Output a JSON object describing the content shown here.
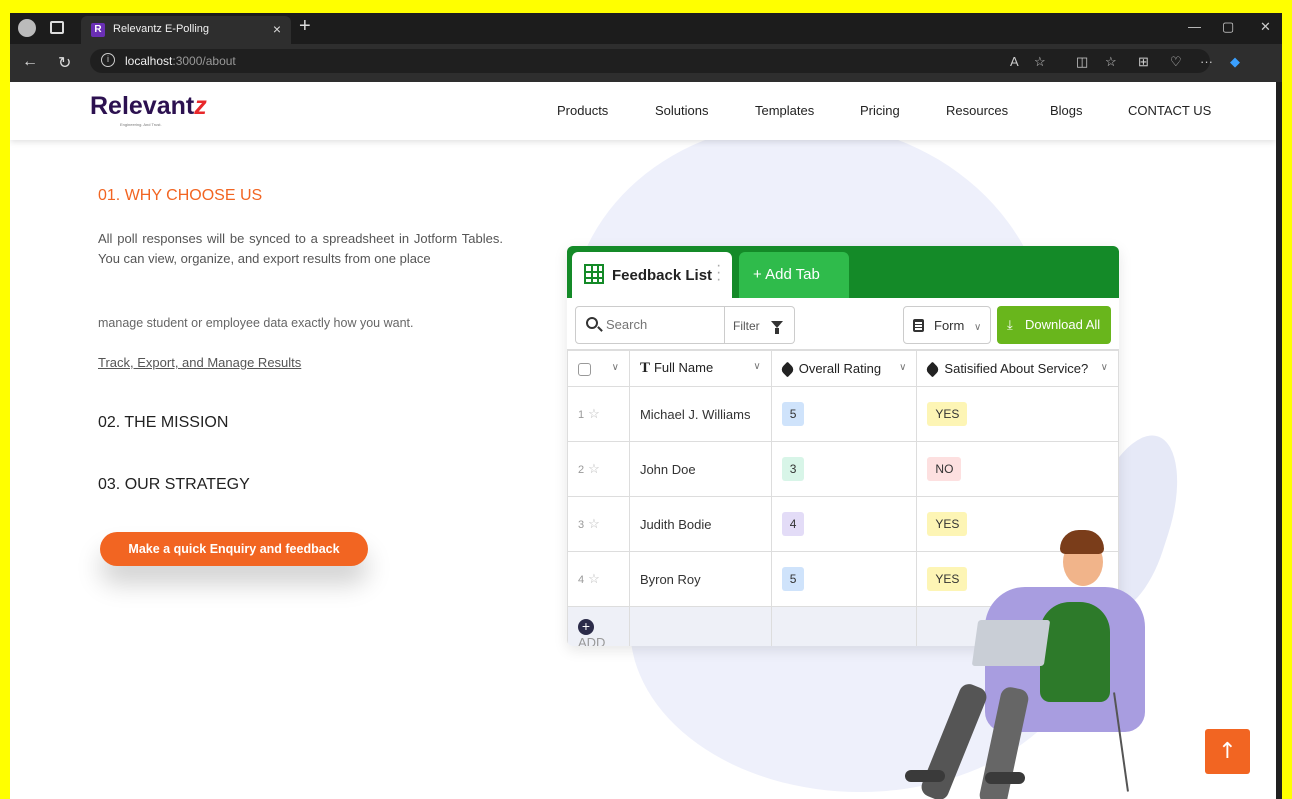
{
  "browser": {
    "tab_title": "Relevantz E-Polling",
    "tab_close": "×",
    "new_tab": "+",
    "url_host": "localhost",
    "url_path": ":3000/about"
  },
  "header": {
    "logo_text": "Relevant",
    "logo_z": "z",
    "logo_tagline": "Engineering. And Trust.",
    "menu": [
      "Products",
      "Solutions",
      "Templates",
      "Pricing",
      "Resources",
      "Blogs",
      "CONTACT US"
    ]
  },
  "content": {
    "why_heading": "01. WHY CHOOSE US",
    "why_paragraph": "All poll responses will be synced to a spreadsheet in Jotform Tables. You can view, organize, and export results from one place",
    "why_sub": "manage student or employee data exactly how you want.",
    "why_link": "Track, Export, and Manage Results",
    "mission_heading": "02. THE MISSION",
    "strategy_heading": "03. OUR STRATEGY",
    "cta_label": "Make a quick Enquiry and feedback"
  },
  "table_card": {
    "tab_label": "Feedback List",
    "add_tab_label": "+ Add Tab",
    "search_placeholder": "Search",
    "filter_label": "Filter",
    "form_label": "Form",
    "download_label": "Download All",
    "columns": [
      "Full Name",
      "Overall Rating",
      "Satisified About Service?"
    ],
    "rows": [
      {
        "index": "1",
        "name": "Michael J. Williams",
        "rating": "5",
        "satisfied": "YES"
      },
      {
        "index": "2",
        "name": "John Doe",
        "rating": "3",
        "satisfied": "NO"
      },
      {
        "index": "3",
        "name": "Judith Bodie",
        "rating": "4",
        "satisfied": "YES"
      },
      {
        "index": "4",
        "name": "Byron Roy",
        "rating": "5",
        "satisfied": "YES"
      }
    ],
    "add_label": "ADD"
  },
  "colors": {
    "accent_orange": "#f26522",
    "table_green": "#148a28",
    "download_green": "#69b61c",
    "rating_5": "#cfe3fb",
    "rating_3": "#d8f5e8",
    "rating_4": "#e3dcf7",
    "yes_bg": "#fdf5b5",
    "no_bg": "#fde0e0"
  },
  "scroll_top_icon": "arrow-up-icon"
}
